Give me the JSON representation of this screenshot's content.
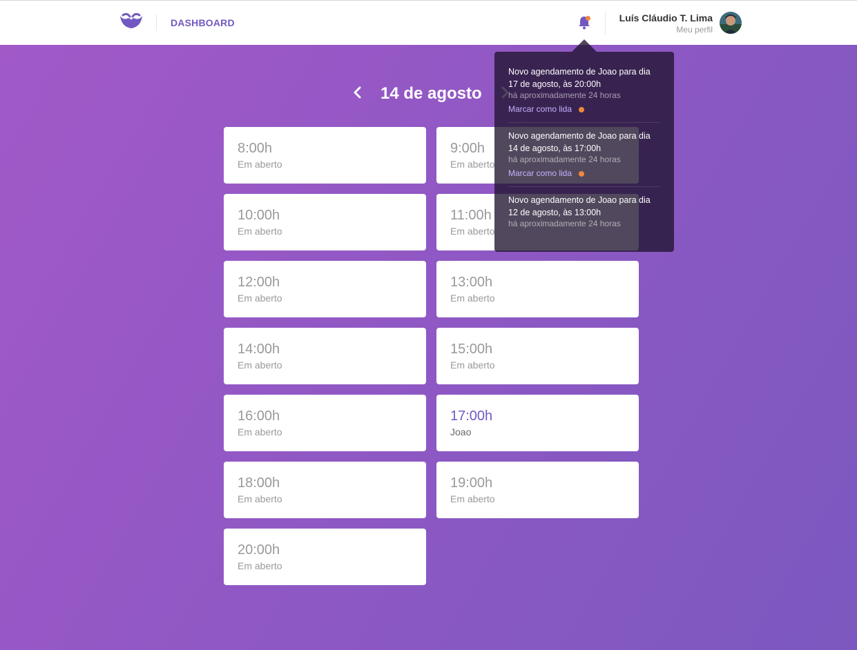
{
  "header": {
    "nav_title": "DASHBOARD",
    "user_name": "Luís Cláudio T. Lima",
    "profile_link": "Meu perfil",
    "brand_color": "#7159c1",
    "badge_color": "#f0873b"
  },
  "day": {
    "label": "14 de agosto"
  },
  "schedule": [
    {
      "time": "8:00h",
      "who": "Em aberto",
      "taken": false
    },
    {
      "time": "9:00h",
      "who": "Em aberto",
      "taken": false
    },
    {
      "time": "10:00h",
      "who": "Em aberto",
      "taken": false
    },
    {
      "time": "11:00h",
      "who": "Em aberto",
      "taken": false
    },
    {
      "time": "12:00h",
      "who": "Em aberto",
      "taken": false
    },
    {
      "time": "13:00h",
      "who": "Em aberto",
      "taken": false
    },
    {
      "time": "14:00h",
      "who": "Em aberto",
      "taken": false
    },
    {
      "time": "15:00h",
      "who": "Em aberto",
      "taken": false
    },
    {
      "time": "16:00h",
      "who": "Em aberto",
      "taken": false
    },
    {
      "time": "17:00h",
      "who": "Joao",
      "taken": true
    },
    {
      "time": "18:00h",
      "who": "Em aberto",
      "taken": false
    },
    {
      "time": "19:00h",
      "who": "Em aberto",
      "taken": false
    },
    {
      "time": "20:00h",
      "who": "Em aberto",
      "taken": false
    }
  ],
  "notifications": [
    {
      "message": "Novo agendamento de Joao para dia 17 de agosto, às 20:00h",
      "time_ago": "há aproximadamente 24 horas",
      "mark_label": "Marcar como lida"
    },
    {
      "message": "Novo agendamento de Joao para dia 14 de agosto, às 17:00h",
      "time_ago": "há aproximadamente 24 horas",
      "mark_label": "Marcar como lida"
    },
    {
      "message": "Novo agendamento de Joao para dia 12 de agosto, às 13:00h",
      "time_ago": "há aproximadamente 24 horas",
      "mark_label": null
    }
  ]
}
